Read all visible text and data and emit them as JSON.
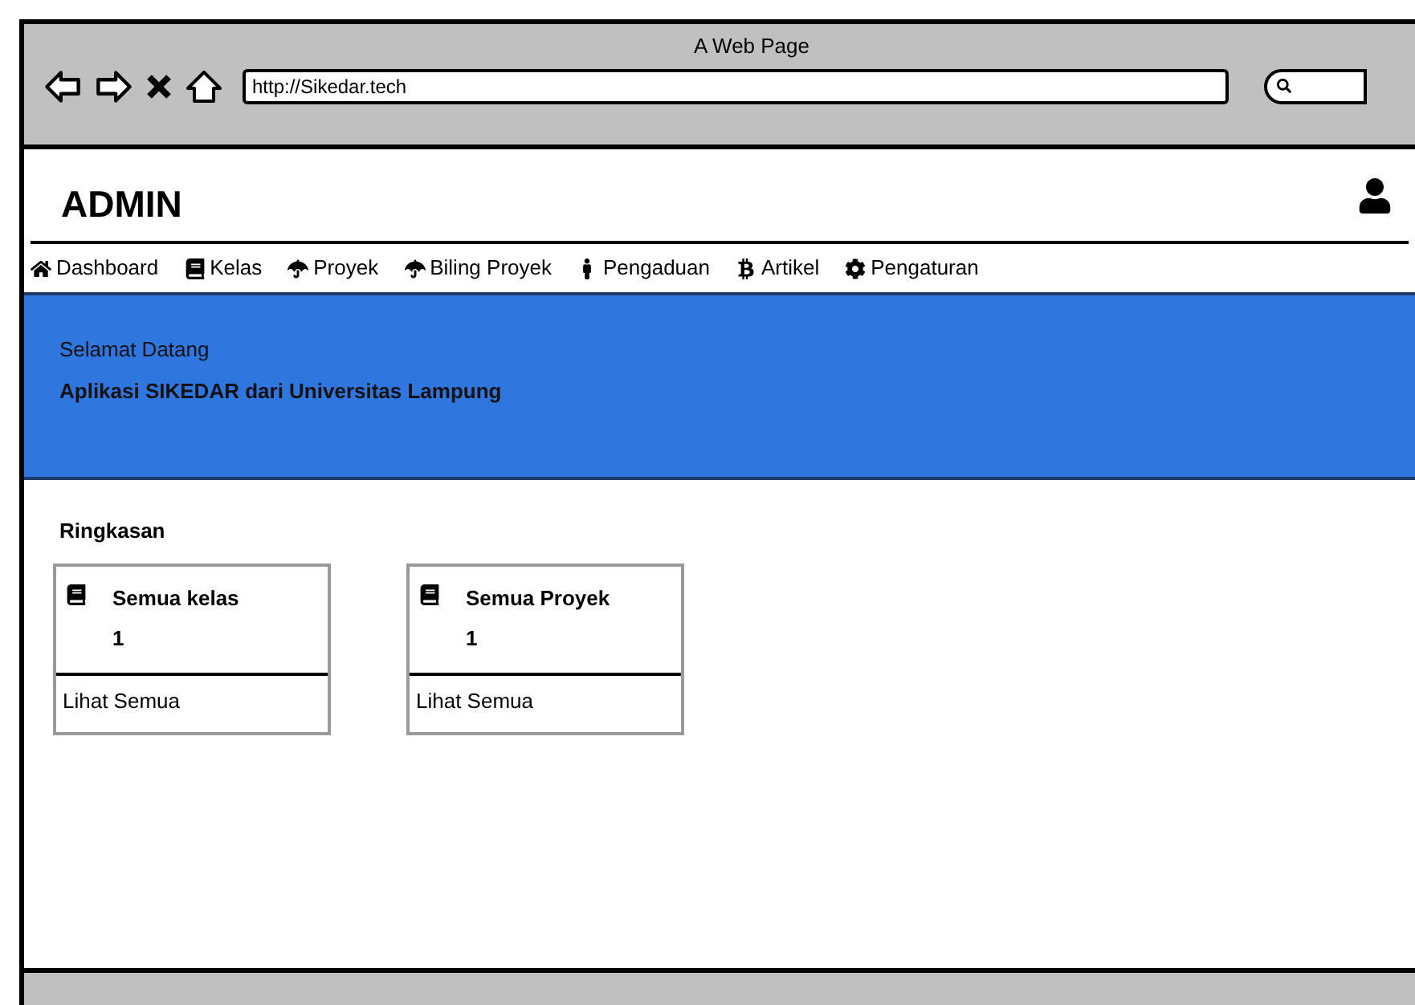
{
  "window": {
    "title": "A Web Page",
    "url": "http://Sikedar.tech"
  },
  "header": {
    "title": "ADMIN"
  },
  "nav": [
    {
      "label": "Dashboard"
    },
    {
      "label": "Kelas"
    },
    {
      "label": "Proyek"
    },
    {
      "label": "Biling Proyek"
    },
    {
      "label": "Pengaduan"
    },
    {
      "label": "Artikel"
    },
    {
      "label": "Pengaturan"
    }
  ],
  "banner": {
    "greeting": "Selamat Datang",
    "subtitle": "Aplikasi SIKEDAR dari Universitas Lampung"
  },
  "summary": {
    "title": "Ringkasan",
    "cards": [
      {
        "title": "Semua kelas",
        "count": "1",
        "link": "Lihat Semua"
      },
      {
        "title": "Semua Proyek",
        "count": "1",
        "link": "Lihat Semua"
      }
    ]
  }
}
